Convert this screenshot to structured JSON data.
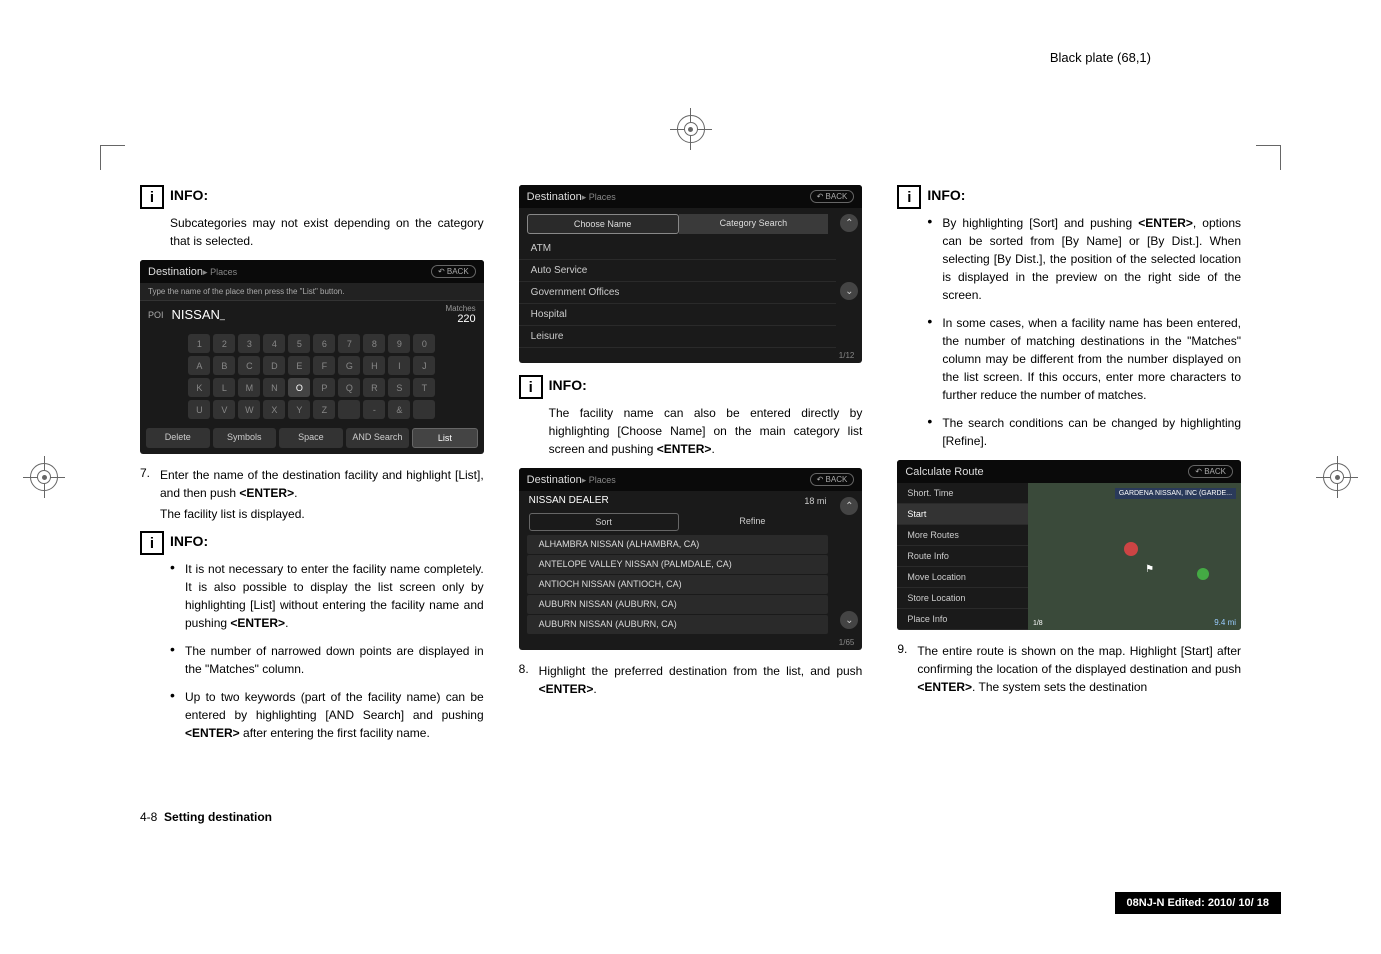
{
  "header": {
    "plate_text": "Black plate (68,1)"
  },
  "col1": {
    "info1": {
      "label": "INFO:",
      "text": "Subcategories may not exist depending on the category that is selected."
    },
    "ss1": {
      "title": "Destination",
      "subtitle": "▸ Places",
      "back": "↶ BACK",
      "instruction": "Type the name of the place then press the \"List\" button.",
      "poi_label": "POI",
      "input": "NISSAN",
      "cursor": "_",
      "matches_label": "Matches",
      "matches_count": "220",
      "bottom": {
        "delete": "Delete",
        "symbols": "Symbols",
        "space": "Space",
        "and": "AND Search",
        "list": "List"
      }
    },
    "step7": {
      "num": "7.",
      "text1": "Enter the name of the destination facility and highlight [List], and then push ",
      "bold1": "<ENTER>",
      "text2": ".",
      "text3": "The facility list is displayed."
    },
    "info2": {
      "label": "INFO:",
      "b1": "It is not necessary to enter the facility name completely. It is also possible to display the list screen only by highlighting [List] without entering the facility name and pushing ",
      "b1_bold": "<ENTER>",
      "b1_end": ".",
      "b2": "The number of narrowed down points are displayed in the \"Matches\" column.",
      "b3": "Up to two keywords (part of the facility name) can be entered by highlighting [AND Search] and pushing ",
      "b3_bold": "<ENTER>",
      "b3_end": " after entering the first facility name."
    }
  },
  "col2": {
    "ss2": {
      "title": "Destination",
      "subtitle": "▸ Places",
      "back": "↶ BACK",
      "tab1": "Choose Name",
      "tab2": "Category Search",
      "items": [
        "ATM",
        "Auto Service",
        "Government Offices",
        "Hospital",
        "Leisure"
      ],
      "page": "1/12"
    },
    "info3": {
      "label": "INFO:",
      "text1": "The facility name can also be entered directly by highlighting [Choose Name] on the main category list screen and pushing ",
      "bold": "<ENTER>",
      "text2": "."
    },
    "ss3": {
      "title": "Destination",
      "subtitle": "▸ Places",
      "back": "↶ BACK",
      "name": "NISSAN DEALER",
      "dist": "18 mi",
      "sort": "Sort",
      "refine": "Refine",
      "items": [
        "ALHAMBRA NISSAN (ALHAMBRA, CA)",
        "ANTELOPE VALLEY NISSAN (PALMDALE, CA)",
        "ANTIOCH NISSAN (ANTIOCH, CA)",
        "AUBURN NISSAN (AUBURN, CA)",
        "AUBURN NISSAN (AUBURN, CA)"
      ],
      "page": "1/65"
    },
    "step8": {
      "num": "8.",
      "text1": "Highlight the preferred destination from the list, and push ",
      "bold": "<ENTER>",
      "text2": "."
    }
  },
  "col3": {
    "info4": {
      "label": "INFO:",
      "b1_a": "By highlighting [Sort] and pushing ",
      "b1_bold": "<ENTER>",
      "b1_b": ", options can be sorted from [By Name] or [By Dist.]. When selecting [By Dist.], the position of the selected location is displayed in the preview on the right side of the screen.",
      "b2": "In some cases, when a facility name has been entered, the number of matching destinations in the \"Matches\" column may be different from the number displayed on the list screen. If this occurs, enter more characters to further reduce the number of matches.",
      "b3": "The search conditions can be changed by highlighting [Refine]."
    },
    "ss4": {
      "title": "Calculate Route",
      "back": "↶ BACK",
      "menu": [
        "Short. Time",
        "Start",
        "More Routes",
        "Route Info",
        "Move Location",
        "Store Location",
        "Place Info"
      ],
      "map_label": "GARDENA NISSAN, INC (GARDE...",
      "scale": "1/8",
      "dist": "9.4 mi"
    },
    "step9": {
      "num": "9.",
      "text1": "The entire route is shown on the map. Highlight [Start] after confirming the location of the displayed destination and push ",
      "bold": "<ENTER>",
      "text2": ". The system sets the destination"
    }
  },
  "footer": {
    "page_num": "4-8",
    "page_title": "Setting destination",
    "edited": "08NJ-N Edited:  2010/ 10/ 18"
  }
}
